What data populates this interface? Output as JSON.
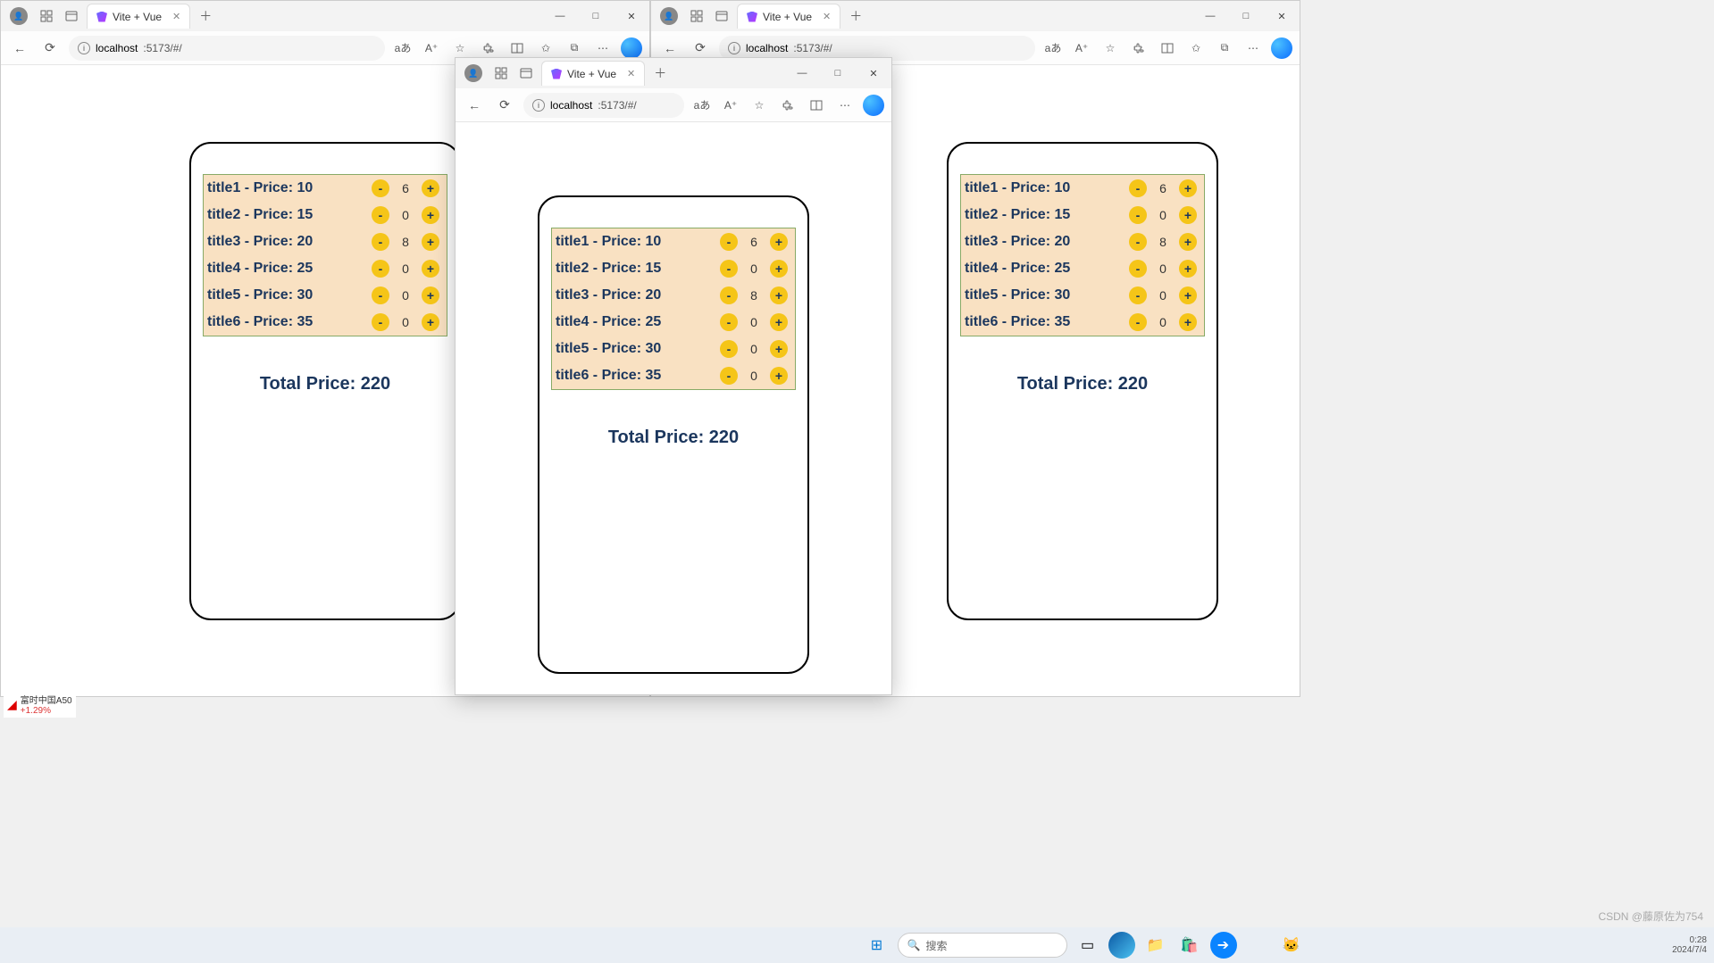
{
  "tab_title": "Vite + Vue",
  "url_host": "localhost",
  "url_path": ":5173/#/",
  "aa": "aあ",
  "win_min": "—",
  "win_max": "□",
  "win_close": "✕",
  "newtab": "＋",
  "tab_close": "✕",
  "search_ph": "搜索",
  "items": [
    {
      "label": "title1 - Price: 10",
      "count": "6"
    },
    {
      "label": "title2 - Price: 15",
      "count": "0"
    },
    {
      "label": "title3 - Price: 20",
      "count": "8"
    },
    {
      "label": "title4 - Price: 25",
      "count": "0"
    },
    {
      "label": "title5 - Price: 30",
      "count": "0"
    },
    {
      "label": "title6 - Price: 35",
      "count": "0"
    }
  ],
  "minus": "-",
  "plus": "+",
  "total": "Total Price: 220",
  "stock_name": "富时中国A50",
  "stock_pct": "+1.29%",
  "watermark": "CSDN @藤原佐为754",
  "clock_time": "0:28",
  "clock_date": "2024/7/4"
}
